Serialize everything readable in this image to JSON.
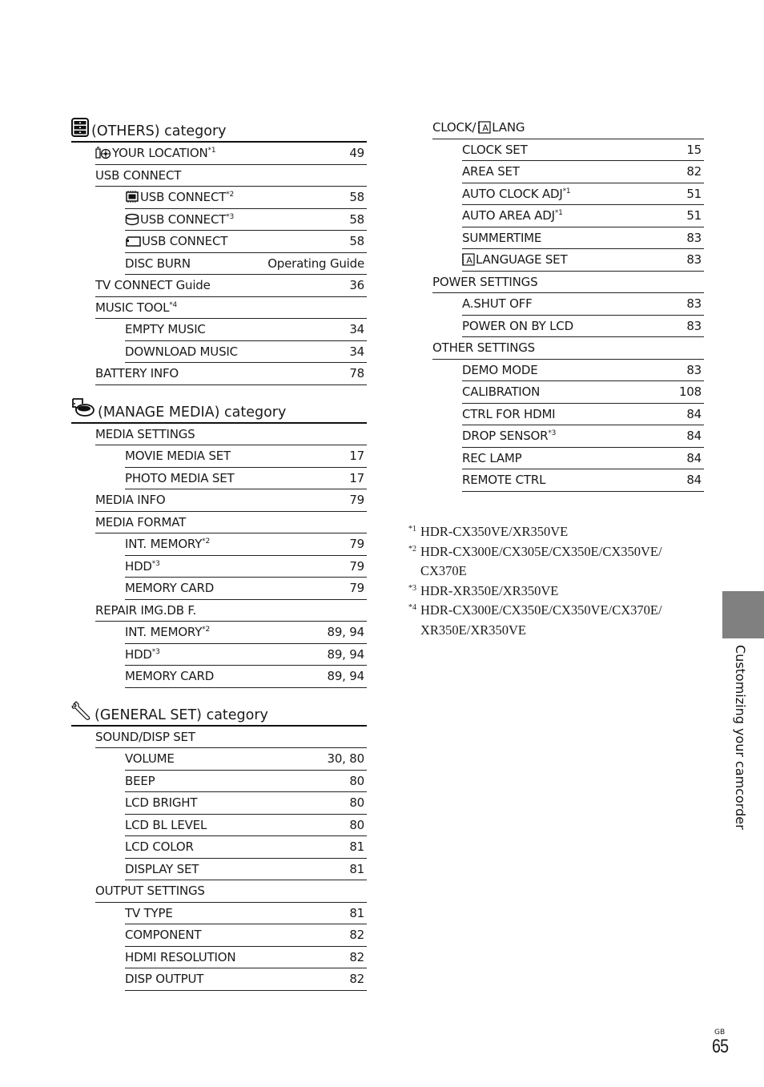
{
  "left": {
    "others": {
      "title": "(OTHERS) category",
      "icon": "others-icon",
      "rows": [
        {
          "level": 1,
          "icon": "location-icon",
          "label": "YOUR LOCATION",
          "note": "*1",
          "page": "49"
        },
        {
          "level": 1,
          "label": "USB CONNECT",
          "page": ""
        },
        {
          "level": 2,
          "icon": "internal-memory-icon",
          "label": "USB CONNECT",
          "note": "*2",
          "page": "58"
        },
        {
          "level": 2,
          "icon": "hdd-icon",
          "label": "USB CONNECT",
          "note": "*3",
          "page": "58"
        },
        {
          "level": 2,
          "icon": "memory-card-icon",
          "label": "USB CONNECT",
          "page": "58"
        },
        {
          "level": 2,
          "label": "DISC BURN",
          "page": "Operating Guide"
        },
        {
          "level": 1,
          "label": "TV CONNECT Guide",
          "page": "36"
        },
        {
          "level": 1,
          "label": "MUSIC TOOL",
          "note": "*4",
          "page": ""
        },
        {
          "level": 2,
          "label": "EMPTY MUSIC",
          "page": "34"
        },
        {
          "level": 2,
          "label": "DOWNLOAD MUSIC",
          "page": "34"
        },
        {
          "level": 1,
          "label": "BATTERY INFO",
          "page": "78"
        }
      ]
    },
    "manage_media": {
      "title": "(MANAGE MEDIA) category",
      "icon": "manage-media-icon",
      "rows": [
        {
          "level": 1,
          "label": "MEDIA SETTINGS",
          "page": ""
        },
        {
          "level": 2,
          "label": "MOVIE MEDIA SET",
          "page": "17"
        },
        {
          "level": 2,
          "label": "PHOTO MEDIA SET",
          "page": "17"
        },
        {
          "level": 1,
          "label": "MEDIA INFO",
          "page": "79"
        },
        {
          "level": 1,
          "label": "MEDIA FORMAT",
          "page": ""
        },
        {
          "level": 2,
          "label": "INT. MEMORY",
          "note": "*2",
          "page": "79"
        },
        {
          "level": 2,
          "label": "HDD",
          "note": "*3",
          "page": "79"
        },
        {
          "level": 2,
          "label": "MEMORY CARD",
          "page": "79"
        },
        {
          "level": 1,
          "label": "REPAIR IMG.DB F.",
          "page": ""
        },
        {
          "level": 2,
          "label": "INT. MEMORY",
          "note": "*2",
          "page": "89, 94"
        },
        {
          "level": 2,
          "label": "HDD",
          "note": "*3",
          "page": "89, 94"
        },
        {
          "level": 2,
          "label": "MEMORY CARD",
          "page": "89, 94"
        }
      ]
    },
    "general_set": {
      "title": "(GENERAL SET) category",
      "icon": "wrench-icon",
      "rows": [
        {
          "level": 1,
          "label": "SOUND/DISP SET",
          "page": ""
        },
        {
          "level": 2,
          "label": "VOLUME",
          "page": "30, 80"
        },
        {
          "level": 2,
          "label": "BEEP",
          "page": "80"
        },
        {
          "level": 2,
          "label": "LCD BRIGHT",
          "page": "80"
        },
        {
          "level": 2,
          "label": "LCD BL LEVEL",
          "page": "80"
        },
        {
          "level": 2,
          "label": "LCD COLOR",
          "page": "81"
        },
        {
          "level": 2,
          "label": "DISPLAY SET",
          "page": "81"
        },
        {
          "level": 1,
          "label": "OUTPUT SETTINGS",
          "page": ""
        },
        {
          "level": 2,
          "label": "TV TYPE",
          "page": "81"
        },
        {
          "level": 2,
          "label": "COMPONENT",
          "page": "82"
        },
        {
          "level": 2,
          "label": "HDMI RESOLUTION",
          "page": "82"
        },
        {
          "level": 2,
          "label": "DISP OUTPUT",
          "page": "82"
        }
      ]
    }
  },
  "right": {
    "rows": [
      {
        "level": 1,
        "label": "CLOCK/",
        "icon_after": "language-icon",
        "label_after": "LANG",
        "page": ""
      },
      {
        "level": 2,
        "label": "CLOCK SET",
        "page": "15"
      },
      {
        "level": 2,
        "label": "AREA SET",
        "page": "82"
      },
      {
        "level": 2,
        "label": "AUTO CLOCK ADJ",
        "note": "*1",
        "page": "51"
      },
      {
        "level": 2,
        "label": "AUTO AREA ADJ",
        "note": "*1",
        "page": "51"
      },
      {
        "level": 2,
        "label": "SUMMERTIME",
        "page": "83"
      },
      {
        "level": 2,
        "icon": "language-icon",
        "label": "LANGUAGE SET",
        "page": "83"
      },
      {
        "level": 1,
        "label": "POWER SETTINGS",
        "page": ""
      },
      {
        "level": 2,
        "label": "A.SHUT OFF",
        "page": "83"
      },
      {
        "level": 2,
        "label": "POWER ON BY LCD",
        "page": "83"
      },
      {
        "level": 1,
        "label": "OTHER SETTINGS",
        "page": ""
      },
      {
        "level": 2,
        "label": "DEMO MODE",
        "page": "83"
      },
      {
        "level": 2,
        "label": "CALIBRATION",
        "page": "108"
      },
      {
        "level": 2,
        "label": "CTRL FOR HDMI",
        "page": "84"
      },
      {
        "level": 2,
        "label": "DROP SENSOR",
        "note": "*3",
        "page": "84"
      },
      {
        "level": 2,
        "label": "REC LAMP",
        "page": "84"
      },
      {
        "level": 2,
        "label": "REMOTE CTRL",
        "page": "84"
      }
    ]
  },
  "footnotes": [
    {
      "mark": "*1",
      "text": "HDR-CX350VE/XR350VE"
    },
    {
      "mark": "*2",
      "text": "HDR-CX300E/CX305E/CX350E/CX350VE/ CX370E"
    },
    {
      "mark": "*3",
      "text": "HDR-XR350E/XR350VE"
    },
    {
      "mark": "*4",
      "text": "HDR-CX300E/CX350E/CX350VE/CX370E/ XR350E/XR350VE"
    }
  ],
  "side_tab": {
    "label": "Customizing your camcorder",
    "color": "#808080"
  },
  "page": {
    "region": "GB",
    "number": "65"
  }
}
